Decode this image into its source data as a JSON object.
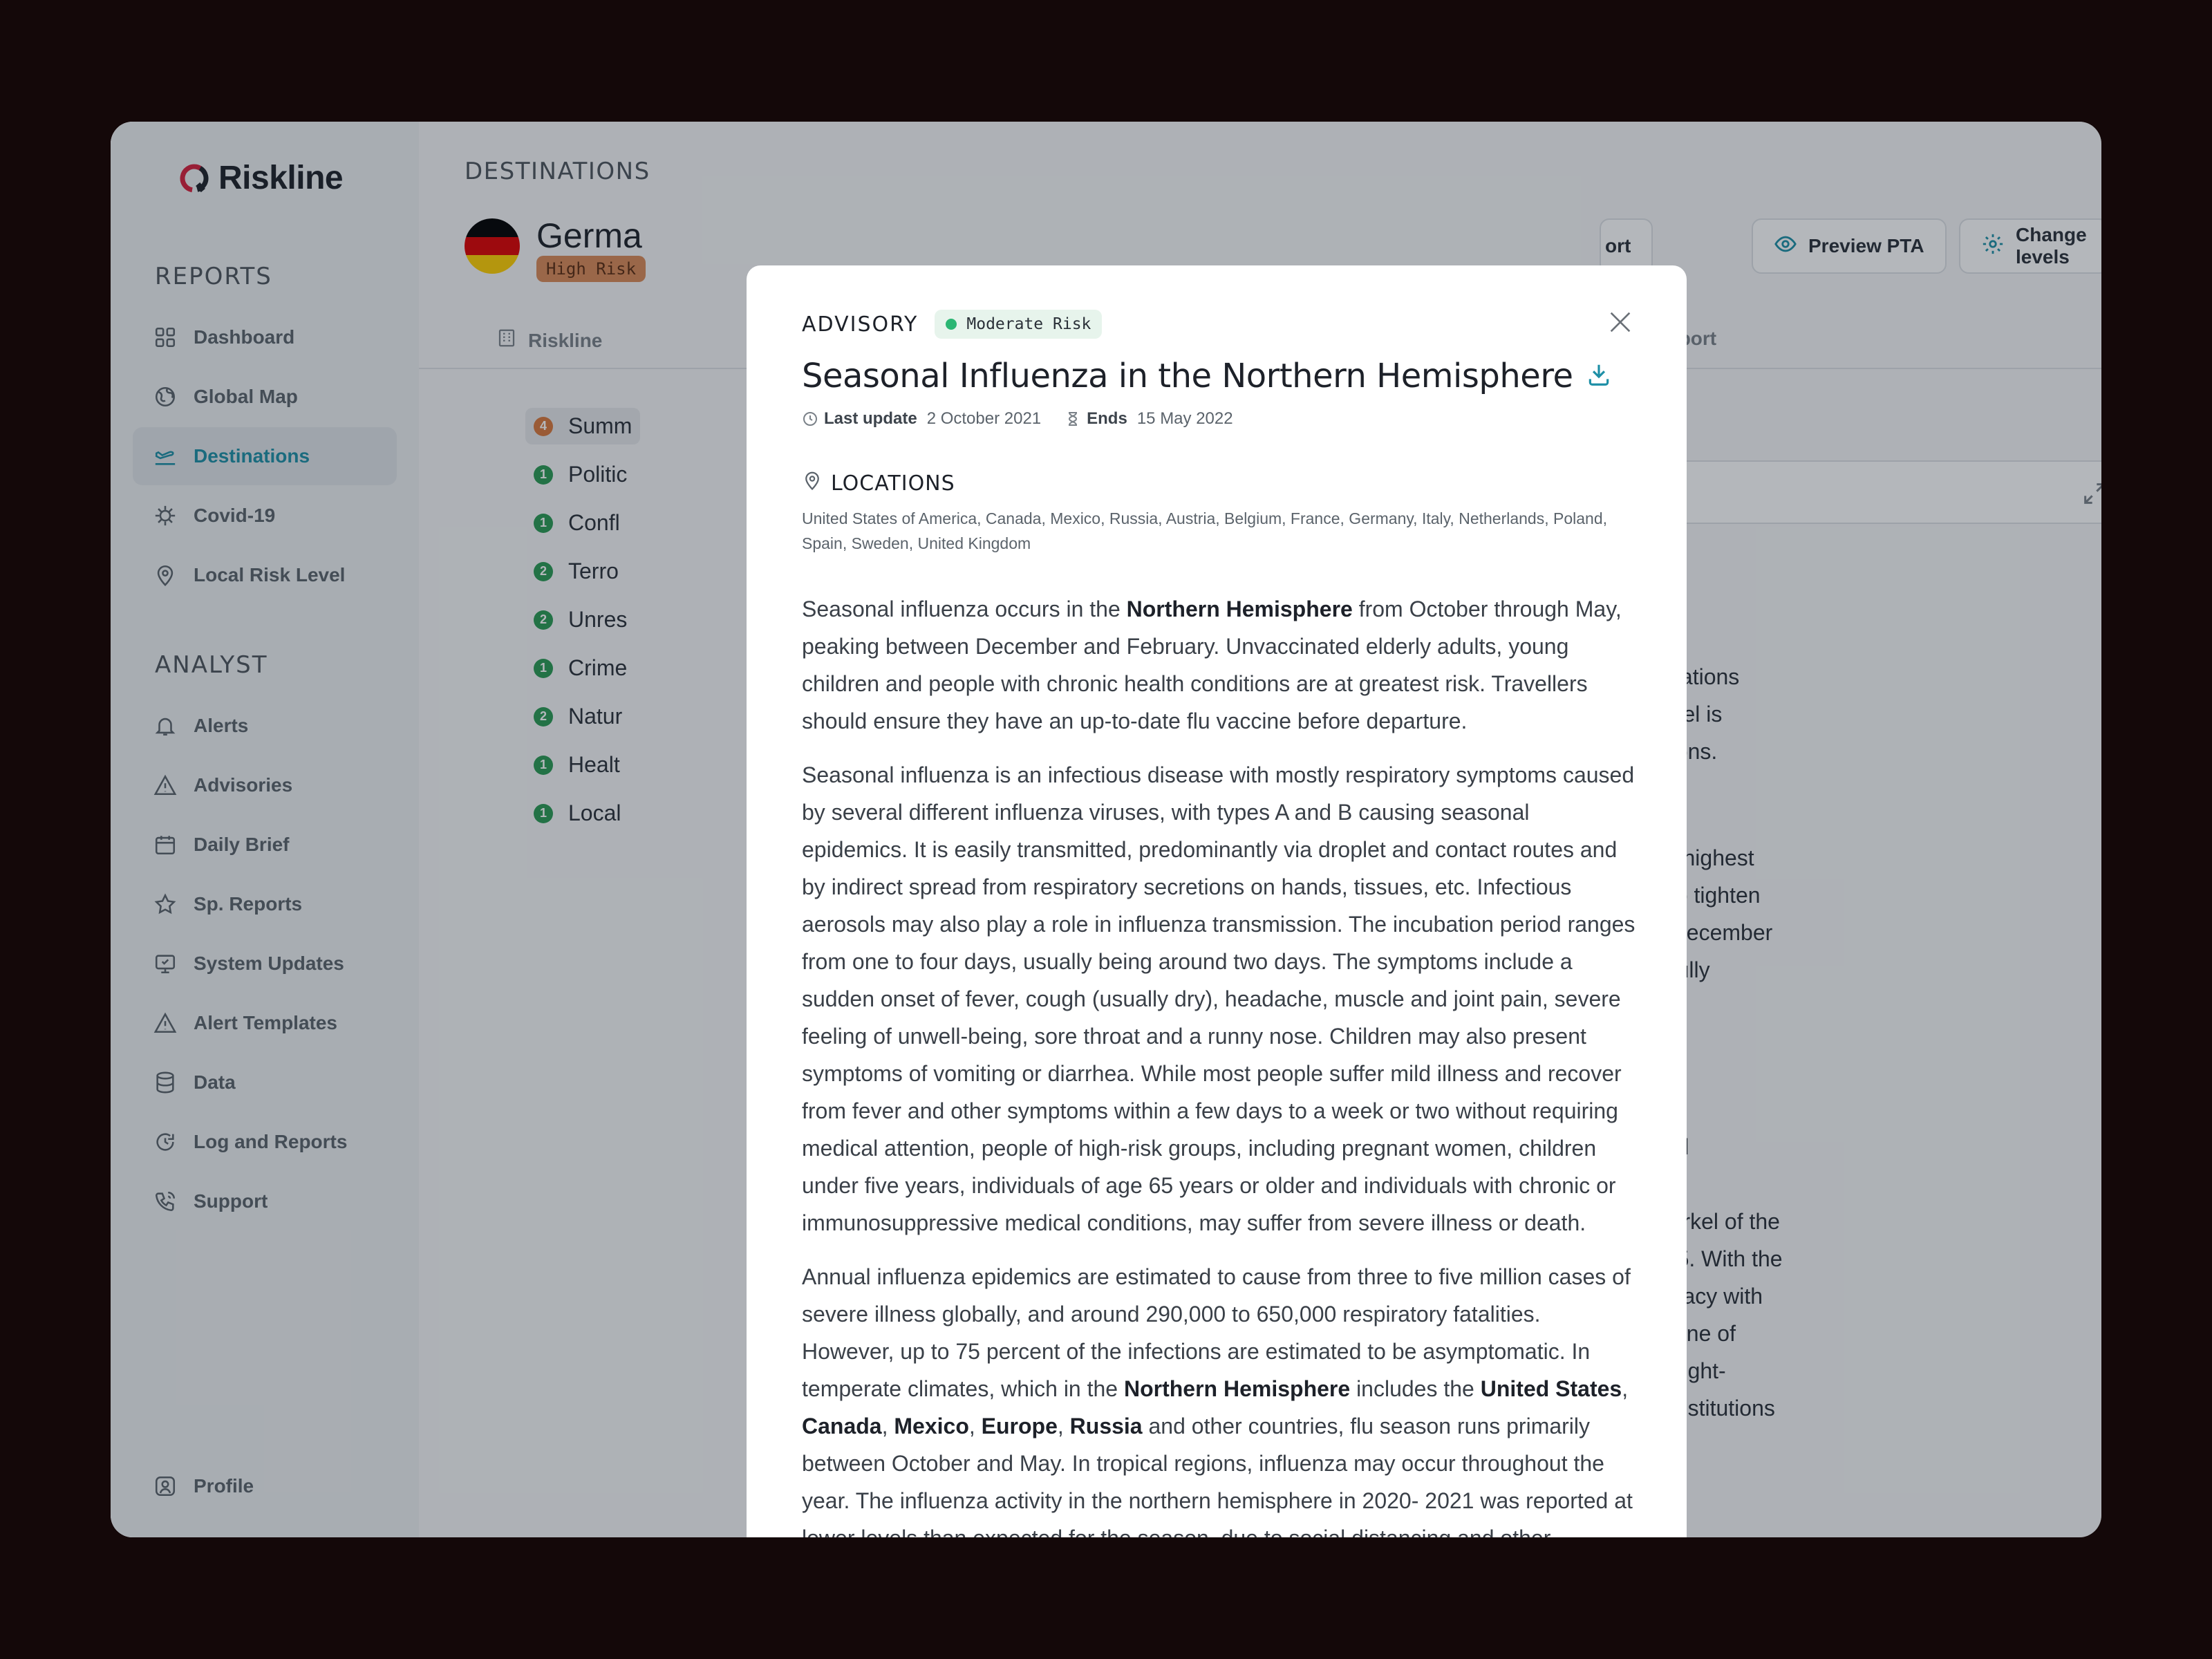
{
  "app": {
    "brand": "Riskline"
  },
  "sidebar": {
    "reports_title": "REPORTS",
    "analyst_title": "ANALYST",
    "reports": [
      {
        "label": "Dashboard",
        "icon": "grid-icon"
      },
      {
        "label": "Global Map",
        "icon": "globe-icon"
      },
      {
        "label": "Destinations",
        "icon": "plane-icon",
        "active": true
      },
      {
        "label": "Covid-19",
        "icon": "virus-icon"
      },
      {
        "label": "Local Risk Level",
        "icon": "pin-icon"
      }
    ],
    "analyst": [
      {
        "label": "Alerts",
        "icon": "bell-icon"
      },
      {
        "label": "Advisories",
        "icon": "warning-icon"
      },
      {
        "label": "Daily Brief",
        "icon": "calendar-icon"
      },
      {
        "label": "Sp. Reports",
        "icon": "star-icon"
      },
      {
        "label": "System Updates",
        "icon": "monitor-check-icon"
      },
      {
        "label": "Alert Templates",
        "icon": "warning-icon"
      },
      {
        "label": "Data",
        "icon": "database-icon"
      },
      {
        "label": "Log and Reports",
        "icon": "refresh-icon"
      },
      {
        "label": "Support",
        "icon": "phone-icon"
      }
    ],
    "profile": "Profile"
  },
  "page": {
    "label": "DESTINATIONS",
    "country": "Germa",
    "risk_badge": "High Risk",
    "tab_riskline": "Riskline",
    "tab_special": "ial Report",
    "btn_report": "ort",
    "btn_preview": "Preview PTA",
    "btn_change": "Change levels",
    "summary": [
      {
        "num": "4",
        "label": "Summ"
      },
      {
        "num": "1",
        "label": "Politic"
      },
      {
        "num": "1",
        "label": "Confl"
      },
      {
        "num": "2",
        "label": "Terro"
      },
      {
        "num": "2",
        "label": "Unres"
      },
      {
        "num": "1",
        "label": "Crime"
      },
      {
        "num": "2",
        "label": "Natur"
      },
      {
        "num": "1",
        "label": "Healt"
      },
      {
        "num": "1",
        "label": "Local"
      }
    ],
    "bg_lines": [
      "locations",
      "ravel is",
      "ptions.",
      "he highest",
      "s to tighten",
      "e December",
      "e fully",
      "eral",
      "a",
      "Merkel of the",
      "005. With the",
      "ocracy with",
      "is one of",
      "in right-",
      "e institutions"
    ]
  },
  "modal": {
    "kicker": "ADVISORY",
    "risk": "Moderate Risk",
    "title": "Seasonal Influenza in the Northern Hemisphere",
    "last_update_label": "Last update",
    "last_update": "2 October 2021",
    "ends_label": "Ends",
    "ends": "15 May 2022",
    "locations_title": "LOCATIONS",
    "locations": "United States of America, Canada, Mexico, Russia, Austria, Belgium, France, Germany, Italy, Netherlands, Poland, Spain, Sweden, United Kingdom",
    "p1": [
      "Seasonal influenza occurs in the ",
      "Northern Hemisphere",
      " from October through May, peaking between December and February. Unvaccinated elderly adults, young children and people with chronic health conditions are at greatest risk. Travellers should ensure they have an up-to-date flu vaccine before departure."
    ],
    "p2": "Seasonal influenza is an infectious disease with mostly respiratory symptoms caused by several different influenza viruses, with types A and B causing seasonal epidemics. It is easily transmitted, predominantly via droplet and contact routes and by indirect spread from respiratory secretions on hands, tissues, etc. Infectious aerosols may also play a role in influenza transmission. The incubation period ranges from one to four days, usually being around two days. The symptoms include a sudden onset of fever, cough (usually dry), headache, muscle and joint pain, severe feeling of unwell-being, sore throat and a runny nose. Children may also present symptoms of vomiting or diarrhea. While most people suffer mild illness and recover from fever and other symptoms within a few days to a week or two without requiring medical attention, people of high-risk groups, including pregnant women, children under five years, individuals of age 65 years or older and individuals with chronic or immunosuppressive medical conditions, may suffer from severe illness or death.",
    "p3": [
      "Annual influenza epidemics are estimated to cause from three to five million cases of severe illness globally, and around 290,000 to 650,000 respiratory fatalities. However, up to 75 percent of the infections are estimated to be asymptomatic. In temperate climates, which in the ",
      "Northern Hemisphere",
      " includes the ",
      "United States",
      ", ",
      "Canada",
      ", ",
      "Mexico",
      ", ",
      "Europe",
      ", ",
      "Russia",
      " and other countries, flu season runs primarily between October and May. In tropical regions, influenza may occur throughout the year. The influenza activity in the northern hemisphere in 2020- 2021 was reported at lower levels than expected for the season, due to social distancing and other measures implemented to"
    ]
  },
  "colors": {
    "accent": "#1d8fa6",
    "brand_red": "#d6203c",
    "moderate": "#2bb673",
    "high_risk": "#d98a58"
  }
}
